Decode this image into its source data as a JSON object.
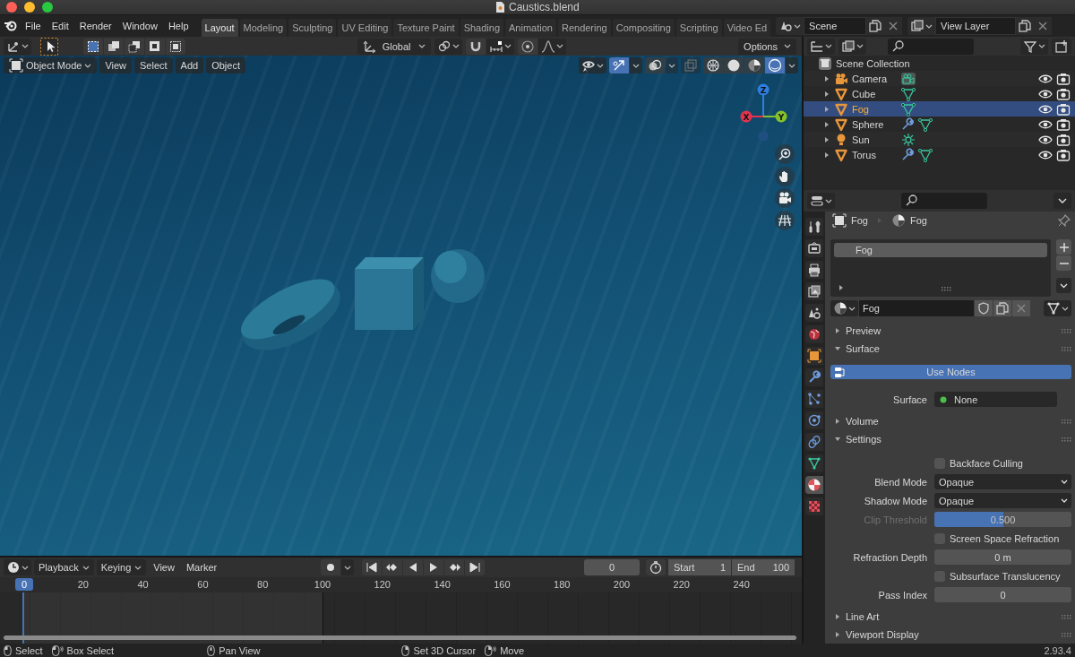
{
  "window": {
    "title": "Caustics.blend"
  },
  "menu": [
    "File",
    "Edit",
    "Render",
    "Window",
    "Help"
  ],
  "workspaces": [
    {
      "label": "Layout",
      "selected": true
    },
    {
      "label": "Modeling",
      "selected": false
    },
    {
      "label": "Sculpting",
      "selected": false
    },
    {
      "label": "UV Editing",
      "selected": false
    },
    {
      "label": "Texture Paint",
      "selected": false
    },
    {
      "label": "Shading",
      "selected": false
    },
    {
      "label": "Animation",
      "selected": false
    },
    {
      "label": "Rendering",
      "selected": false
    },
    {
      "label": "Compositing",
      "selected": false
    },
    {
      "label": "Scripting",
      "selected": false
    },
    {
      "label": "Video Ed",
      "selected": false
    }
  ],
  "scene": "Scene",
  "view_layer": "View Layer",
  "viewport": {
    "orientation": "Global",
    "options": "Options",
    "mode": "Object Mode",
    "menus": [
      "View",
      "Select",
      "Add",
      "Object"
    ],
    "axes": [
      {
        "label": "Z",
        "color": "#2f7fe0"
      },
      {
        "label": "X",
        "color": "#e2344f"
      },
      {
        "label": "Y",
        "color": "#84c22a"
      }
    ]
  },
  "outliner": {
    "root": "Scene Collection",
    "items": [
      {
        "name": "Camera",
        "kind": "camera",
        "selected": false,
        "modified": false
      },
      {
        "name": "Cube",
        "kind": "mesh",
        "selected": false,
        "modified": false
      },
      {
        "name": "Fog",
        "kind": "mesh",
        "selected": true,
        "modified": false
      },
      {
        "name": "Sphere",
        "kind": "mesh",
        "selected": false,
        "modified": true
      },
      {
        "name": "Sun",
        "kind": "light",
        "selected": false,
        "modified": false
      },
      {
        "name": "Torus",
        "kind": "mesh",
        "selected": false,
        "modified": true
      }
    ]
  },
  "properties": {
    "tabs": [
      {
        "kind": "tool",
        "selected": false
      },
      {
        "kind": "render",
        "selected": false
      },
      {
        "kind": "output",
        "selected": false
      },
      {
        "kind": "view_layer",
        "selected": false
      },
      {
        "kind": "scene",
        "selected": false
      },
      {
        "kind": "world",
        "selected": false
      },
      {
        "kind": "object",
        "selected": false
      },
      {
        "kind": "modifiers",
        "selected": false
      },
      {
        "kind": "particles",
        "selected": false
      },
      {
        "kind": "physics",
        "selected": false
      },
      {
        "kind": "constraints",
        "selected": false
      },
      {
        "kind": "data",
        "selected": false
      },
      {
        "kind": "material",
        "selected": true
      },
      {
        "kind": "texture",
        "selected": false
      }
    ],
    "breadcrumb": [
      "Fog",
      "Fog"
    ],
    "slots": [
      {
        "name": "Fog",
        "selected": true
      }
    ],
    "material": "Fog",
    "panels": [
      {
        "title": "Preview",
        "expanded": false
      },
      {
        "title": "Surface",
        "expanded": true,
        "rows": [
          {
            "kind": "toggle",
            "label": "Use Nodes",
            "on": true
          },
          {
            "kind": "socket",
            "label": "Surface",
            "value": "None"
          }
        ]
      },
      {
        "title": "Volume",
        "expanded": false
      },
      {
        "title": "Settings",
        "expanded": true,
        "rows": [
          {
            "kind": "checkbox",
            "label": "Backface Culling",
            "checked": false
          },
          {
            "kind": "dropdown",
            "label": "Blend Mode",
            "value": "Opaque"
          },
          {
            "kind": "dropdown",
            "label": "Shadow Mode",
            "value": "Opaque"
          },
          {
            "kind": "slider",
            "label": "Clip Threshold",
            "value": "0.500",
            "level": 0.5,
            "disabled": true
          },
          {
            "kind": "checkbox",
            "label": "Screen Space Refraction",
            "checked": false
          },
          {
            "kind": "number",
            "label": "Refraction Depth",
            "value": "0 m"
          },
          {
            "kind": "checkbox",
            "label": "Subsurface Translucency",
            "checked": false
          },
          {
            "kind": "number",
            "label": "Pass Index",
            "value": "0"
          }
        ]
      },
      {
        "title": "Line Art",
        "expanded": false
      },
      {
        "title": "Viewport Display",
        "expanded": false
      }
    ]
  },
  "timeline": {
    "menus": [
      {
        "label": "Playback",
        "dropdown": true
      },
      {
        "label": "Keying",
        "dropdown": true
      },
      {
        "label": "View",
        "dropdown": false
      },
      {
        "label": "Marker",
        "dropdown": false
      }
    ],
    "current_frame": "0",
    "start_label": "Start",
    "start": "1",
    "end_label": "End",
    "end": "100",
    "playhead": "0",
    "ticks": [
      "20",
      "40",
      "60",
      "80",
      "100",
      "120",
      "140",
      "160",
      "180",
      "200",
      "220",
      "240"
    ]
  },
  "status_bar": {
    "hints": [
      {
        "kind": "left",
        "label": "Select"
      },
      {
        "kind": "left_drag",
        "label": "Box Select"
      },
      {
        "kind": "middle",
        "label": "Pan View"
      },
      {
        "kind": "right",
        "label": "Set 3D Cursor"
      },
      {
        "kind": "right_drag",
        "label": "Move"
      }
    ],
    "version": "2.93.4"
  }
}
